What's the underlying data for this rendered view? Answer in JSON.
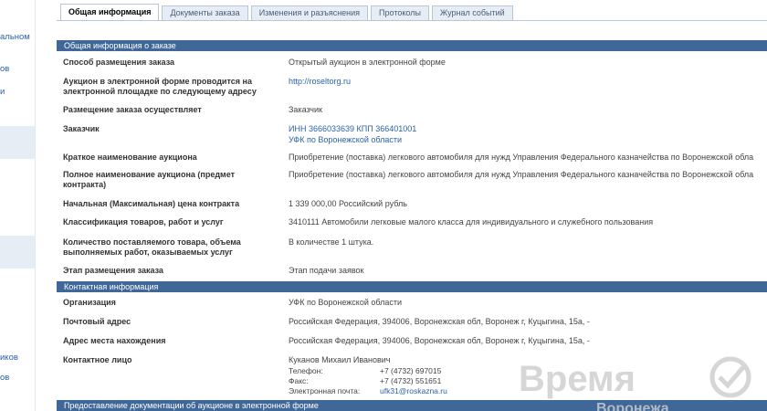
{
  "left_nav": {
    "items": [
      "альном",
      "ов",
      "и",
      "иков",
      "ов"
    ]
  },
  "tabs": [
    {
      "label": "Общая информация",
      "active": true
    },
    {
      "label": "Документы заказа",
      "active": false
    },
    {
      "label": "Изменения и разъяснения",
      "active": false
    },
    {
      "label": "Протоколы",
      "active": false
    },
    {
      "label": "Журнал событий",
      "active": false
    }
  ],
  "sections": {
    "general_title": "Общая информация о заказе",
    "contact_title": "Контактная информация",
    "docs_title": "Предоставление документации об аукционе в электронной форме"
  },
  "general": {
    "method_label": "Способ размещения заказа",
    "method_value": "Открытый аукцион в электронной форме",
    "platform_label": "Аукцион в электронной форме проводится на электронной площадке по следующему адресу",
    "platform_value": "http://roseltorg.ru",
    "placer_label": "Размещение заказа осуществляет",
    "placer_value": "Заказчик",
    "customer_label": "Заказчик",
    "customer_inn": "ИНН 3666033639 КПП 366401001",
    "customer_name": "УФК по Воронежской области",
    "short_name_label": "Краткое наименование аукциона",
    "short_name_value": "Приобретение (поставка) легкового автомобиля для нужд Управления Федерального казначейства по Воронежской обла",
    "full_name_label": "Полное наименование аукциона (предмет контракта)",
    "full_name_value": "Приобретение (поставка) легкового автомобиля для нужд Управления Федерального казначейства по Воронежской обла",
    "price_label": "Начальная (Максимальная) цена контракта",
    "price_value": "1 339 000,00 Российский рубль",
    "class_label": "Классификация товаров, работ и услуг",
    "class_value": "3410111 Автомобили легковые малого класса для индивидуального и служебного пользования",
    "qty_label": "Количество поставляемого товара, объема выполняемых работ, оказываемых услуг",
    "qty_value": "В количестве 1 штука.",
    "stage_label": "Этап размещения заказа",
    "stage_value": "Этап подачи заявок"
  },
  "contact": {
    "org_label": "Организация",
    "org_value": "УФК по Воронежской области",
    "postal_label": "Почтовый адрес",
    "postal_value": "Российская Федерация, 394006, Воронежская обл, Воронеж г, Куцыгина, 15а, -",
    "location_label": "Адрес места нахождения",
    "location_value": "Российская Федерация, 394006, Воронежская обл, Воронеж г, Куцыгина, 15а, -",
    "person_label": "Контактное лицо",
    "person_name": "Куканов Михаил Иванович",
    "phone_key": "Телефон:",
    "phone_value": "+7 (4732) 697015",
    "fax_key": "Факс:",
    "fax_value": "+7 (4732) 551651",
    "email_key": "Электронная почта:",
    "email_value": "ufk31@roskazna.ru"
  },
  "watermark": {
    "text": "Время",
    "sub": "Воронежа",
    "color": "#c8c8c8"
  }
}
